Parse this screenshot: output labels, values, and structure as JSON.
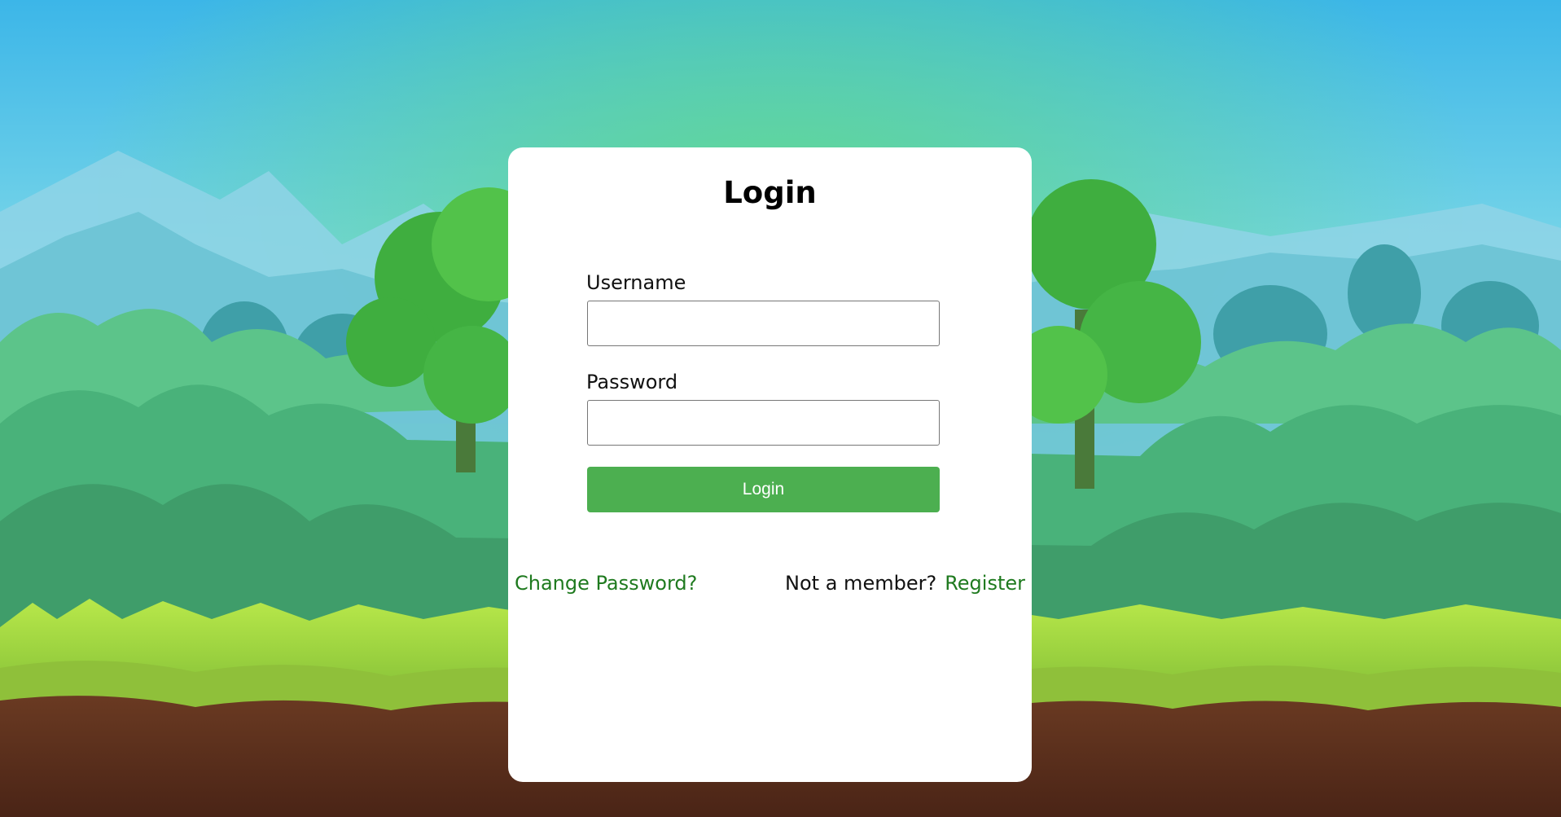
{
  "login_form": {
    "title": "Login",
    "username_label": "Username",
    "username_value": "",
    "password_label": "Password",
    "password_value": "",
    "submit_label": "Login",
    "change_password_link": "Change Password?",
    "not_member_text": "Not a member?",
    "register_link": "Register"
  },
  "colors": {
    "accent_button": "#4caf50",
    "link_text": "#1f7a1f",
    "card_background": "#ffffff",
    "sky_top": "#3cb6e8"
  }
}
